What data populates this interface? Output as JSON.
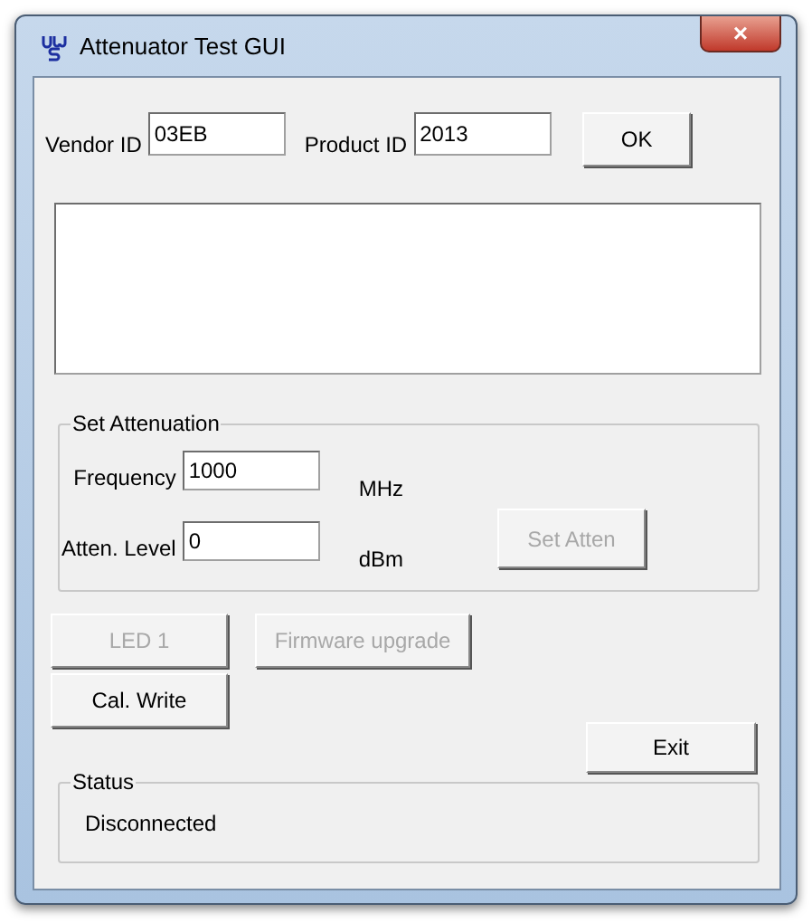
{
  "window": {
    "title": "Attenuator Test GUI",
    "close": "×"
  },
  "ids": [
    {
      "label": "Vendor ID",
      "value": "03EB"
    },
    {
      "label": "Product ID",
      "value": "2013"
    }
  ],
  "ok_button": {
    "label": "OK",
    "disabled": false
  },
  "set_attenuation": {
    "title": "Set Attenuation",
    "fields": [
      {
        "label": "Frequency",
        "value": "1000",
        "unit": "MHz"
      },
      {
        "label": "Atten. Level",
        "value": "0",
        "unit": "dBm"
      }
    ],
    "button": {
      "label": "Set Atten",
      "disabled": true
    }
  },
  "buttons": [
    {
      "label": "LED 1",
      "disabled": true
    },
    {
      "label": "Firmware upgrade",
      "disabled": true
    },
    {
      "label": "Cal. Write",
      "disabled": false
    }
  ],
  "exit_button": {
    "label": "Exit",
    "disabled": false
  },
  "status": {
    "title": "Status",
    "text": "Disconnected"
  }
}
